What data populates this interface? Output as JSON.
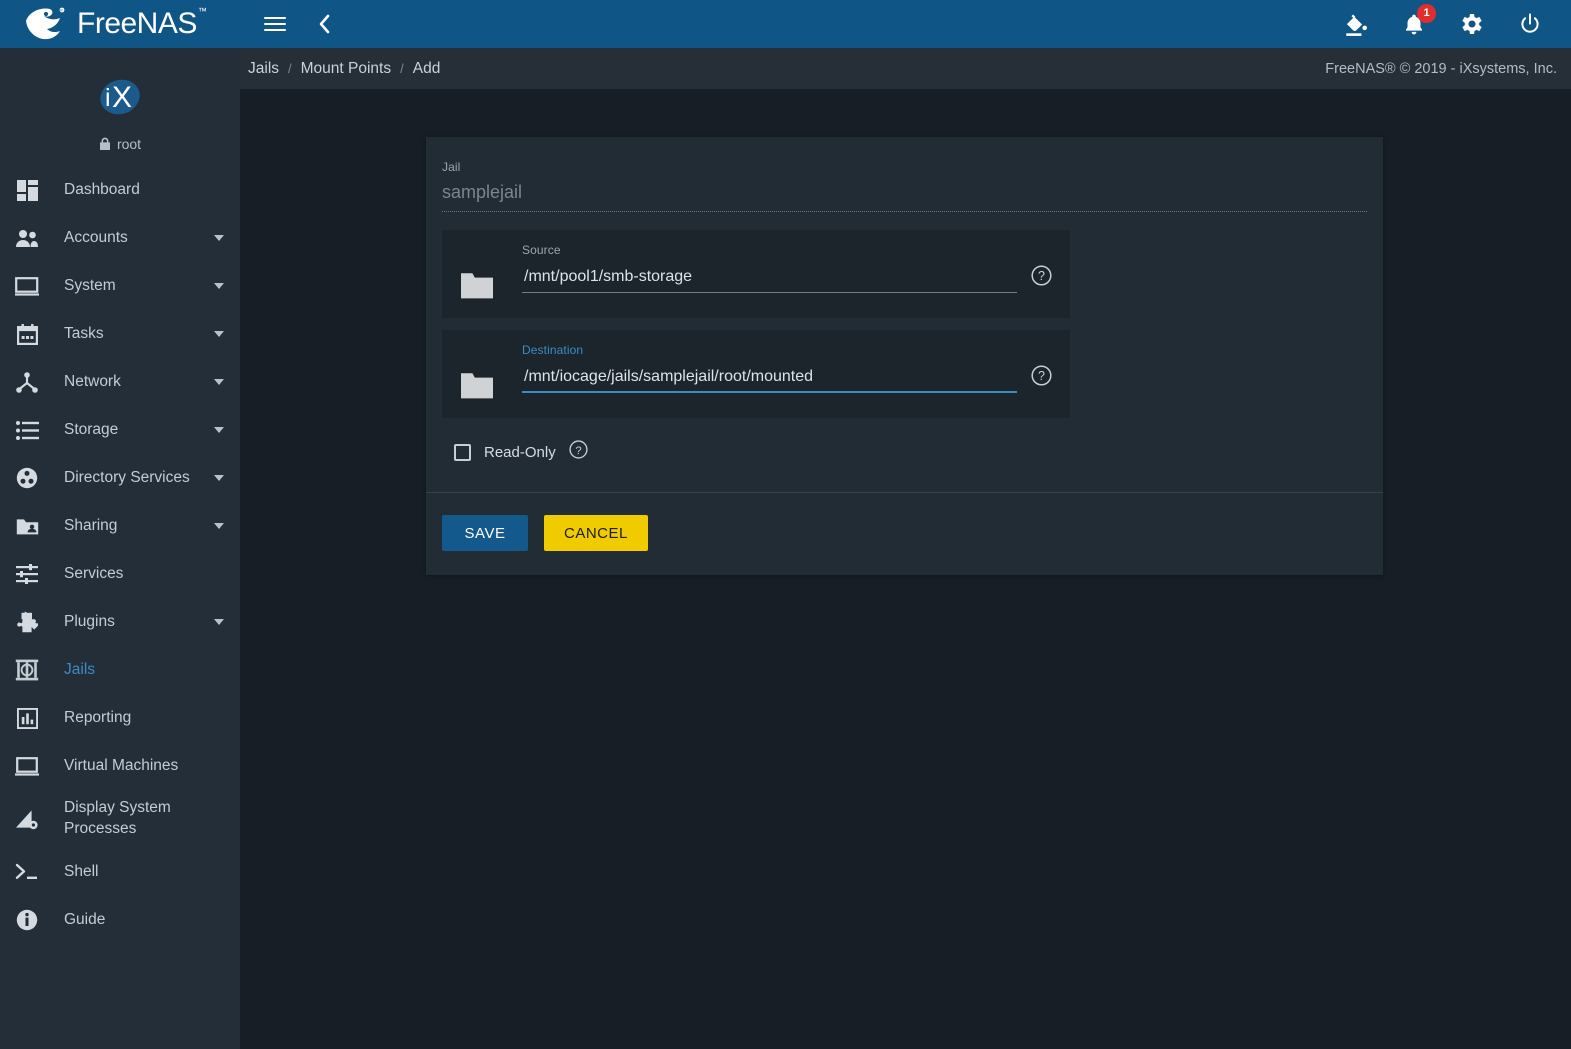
{
  "app": {
    "brand_name": "FreeNAS",
    "brand_tm": "™",
    "logo_icon": "freenas-fish-logo",
    "copyright": "FreeNAS® © 2019 - iXsystems, Inc."
  },
  "topbar": {
    "menu_icon": "hamburger-menu-icon",
    "back_icon": "chevron-left-icon",
    "theme_icon": "paint-bucket-icon",
    "notifications_icon": "bell-icon",
    "notifications_count": "1",
    "settings_icon": "gear-icon",
    "power_icon": "power-icon",
    "accent_color": "#0f5586",
    "badge_color": "#e02e2e"
  },
  "sidebar": {
    "avatar_icon": "ix-logo-avatar",
    "user_lock_icon": "lock-icon",
    "username": "root",
    "items": [
      {
        "label": "Dashboard",
        "icon": "dashboard-grid-icon",
        "expandable": false,
        "active": false
      },
      {
        "label": "Accounts",
        "icon": "people-icon",
        "expandable": true,
        "active": false
      },
      {
        "label": "System",
        "icon": "monitor-icon",
        "expandable": true,
        "active": false
      },
      {
        "label": "Tasks",
        "icon": "calendar-icon",
        "expandable": true,
        "active": false
      },
      {
        "label": "Network",
        "icon": "network-nodes-icon",
        "expandable": true,
        "active": false
      },
      {
        "label": "Storage",
        "icon": "storage-list-icon",
        "expandable": true,
        "active": false
      },
      {
        "label": "Directory Services",
        "icon": "directory-services-icon",
        "expandable": true,
        "active": false
      },
      {
        "label": "Sharing",
        "icon": "sharing-folder-icon",
        "expandable": true,
        "active": false
      },
      {
        "label": "Services",
        "icon": "sliders-icon",
        "expandable": false,
        "active": false
      },
      {
        "label": "Plugins",
        "icon": "puzzle-piece-icon",
        "expandable": true,
        "active": false
      },
      {
        "label": "Jails",
        "icon": "jail-icon",
        "expandable": false,
        "active": true
      },
      {
        "label": "Reporting",
        "icon": "bar-chart-icon",
        "expandable": false,
        "active": false
      },
      {
        "label": "Virtual Machines",
        "icon": "laptop-icon",
        "expandable": false,
        "active": false
      },
      {
        "label": "Display System\nProcesses",
        "icon": "processes-icon",
        "expandable": false,
        "active": false
      },
      {
        "label": "Shell",
        "icon": "terminal-prompt-icon",
        "expandable": false,
        "active": false
      },
      {
        "label": "Guide",
        "icon": "info-circle-icon",
        "expandable": false,
        "active": false
      }
    ],
    "active_color": "#3b8cc4"
  },
  "breadcrumb": {
    "items": [
      "Jails",
      "Mount Points",
      "Add"
    ],
    "separator": "/"
  },
  "form": {
    "jail_field": {
      "label": "Jail",
      "value": "samplejail",
      "disabled": true,
      "caret_icon": "chevron-down-icon"
    },
    "source_field": {
      "label": "Source",
      "value": "/mnt/pool1/smb-storage",
      "placeholder": "",
      "folder_icon": "folder-icon",
      "help_icon": "help-circle-icon",
      "focused": false
    },
    "destination_field": {
      "label": "Destination",
      "value": "/mnt/iocage/jails/samplejail/root/mounted",
      "placeholder": "",
      "folder_icon": "folder-icon",
      "help_icon": "help-circle-icon",
      "focused": true
    },
    "readonly_field": {
      "label": "Read-Only",
      "checked": false,
      "help_icon": "help-circle-icon"
    },
    "buttons": {
      "save_label": "SAVE",
      "save_color": "#13598c",
      "cancel_label": "CANCEL",
      "cancel_color": "#f0cb00"
    }
  }
}
